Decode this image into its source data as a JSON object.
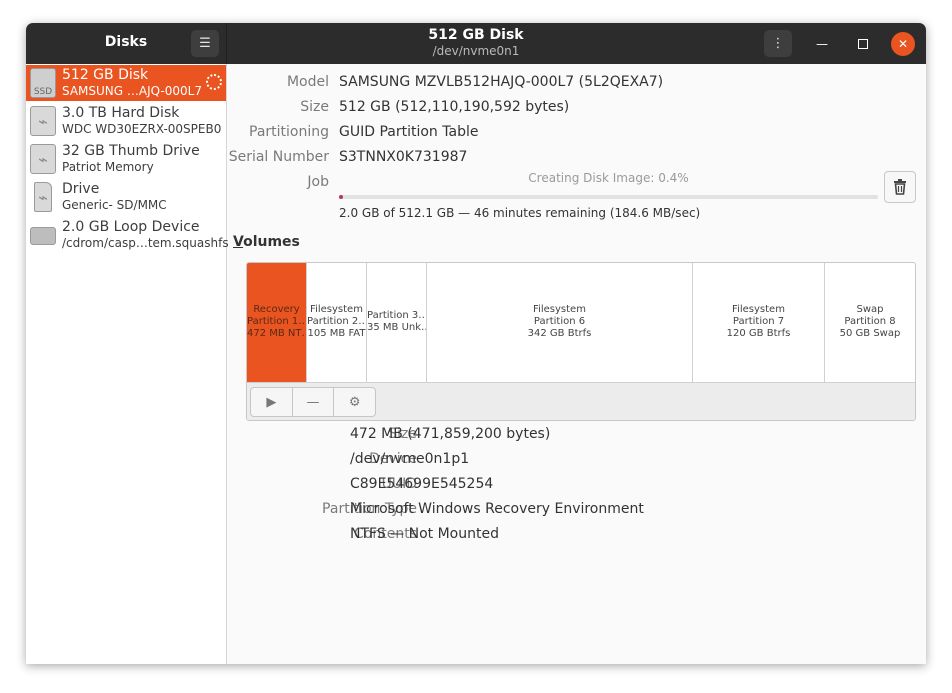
{
  "app": {
    "title": "Disks"
  },
  "header": {
    "title": "512 GB Disk",
    "subtitle": "/dev/nvme0n1"
  },
  "sidebar": {
    "items": [
      {
        "name": "512 GB Disk",
        "sub": "SAMSUNG …AJQ-000L7",
        "icon": "ssd-icon",
        "icon_text": "SSD"
      },
      {
        "name": "3.0 TB Hard Disk",
        "sub": "WDC WD30EZRX-00SPEB0",
        "icon": "usb-drive-icon"
      },
      {
        "name": "32 GB Thumb Drive",
        "sub": "Patriot Memory",
        "icon": "usb-drive-icon"
      },
      {
        "name": "Drive",
        "sub": "Generic- SD/MMC",
        "icon": "sd-card-icon"
      },
      {
        "name": "2.0 GB Loop Device",
        "sub": "/cdrom/casp…tem.squashfs",
        "icon": "loop-device-icon"
      }
    ]
  },
  "disk": {
    "model_label": "Model",
    "model": "SAMSUNG MZVLB512HAJQ-000L7 (5L2QEXA7)",
    "size_label": "Size",
    "size": "512 GB (512,110,190,592 bytes)",
    "partitioning_label": "Partitioning",
    "partitioning": "GUID Partition Table",
    "serial_label": "Serial Number",
    "serial": "S3TNNX0K731987",
    "job_label": "Job",
    "job_status": "Creating Disk Image: 0.4%",
    "job_progress": 0.004,
    "job_detail": "2.0 GB of 512.1 GB — 46 minutes remaining (184.6 MB/sec)"
  },
  "volumes": {
    "heading_accel": "V",
    "heading_rest": "olumes",
    "partitions": [
      {
        "line1": "Recovery",
        "line2": "Partition 1…",
        "line3": "472 MB NT…"
      },
      {
        "line1": "Filesystem",
        "line2": "Partition 2…",
        "line3": "105 MB FAT"
      },
      {
        "line1": "Partition 3…",
        "line2": "35 MB Unk…",
        "line3": ""
      },
      {
        "line1": "Filesystem",
        "line2": "Partition 6",
        "line3": "342 GB Btrfs"
      },
      {
        "line1": "Filesystem",
        "line2": "Partition 7",
        "line3": "120 GB Btrfs"
      },
      {
        "line1": "Swap",
        "line2": "Partition 8",
        "line3": "50 GB Swap"
      }
    ]
  },
  "partition": {
    "size_label": "Size",
    "size": "472 MB (471,859,200 bytes)",
    "device_label": "Device",
    "device": "/dev/nvme0n1p1",
    "uuid_label": "UUID",
    "uuid": "C89E54699E545254",
    "type_label": "Partition Type",
    "type": "Microsoft Windows Recovery Environment",
    "contents_label": "Contents",
    "contents": "NTFS — Not Mounted"
  },
  "colors": {
    "accent": "#e95420",
    "titlebar": "#2c2c2c",
    "progress": "#b0356e"
  }
}
